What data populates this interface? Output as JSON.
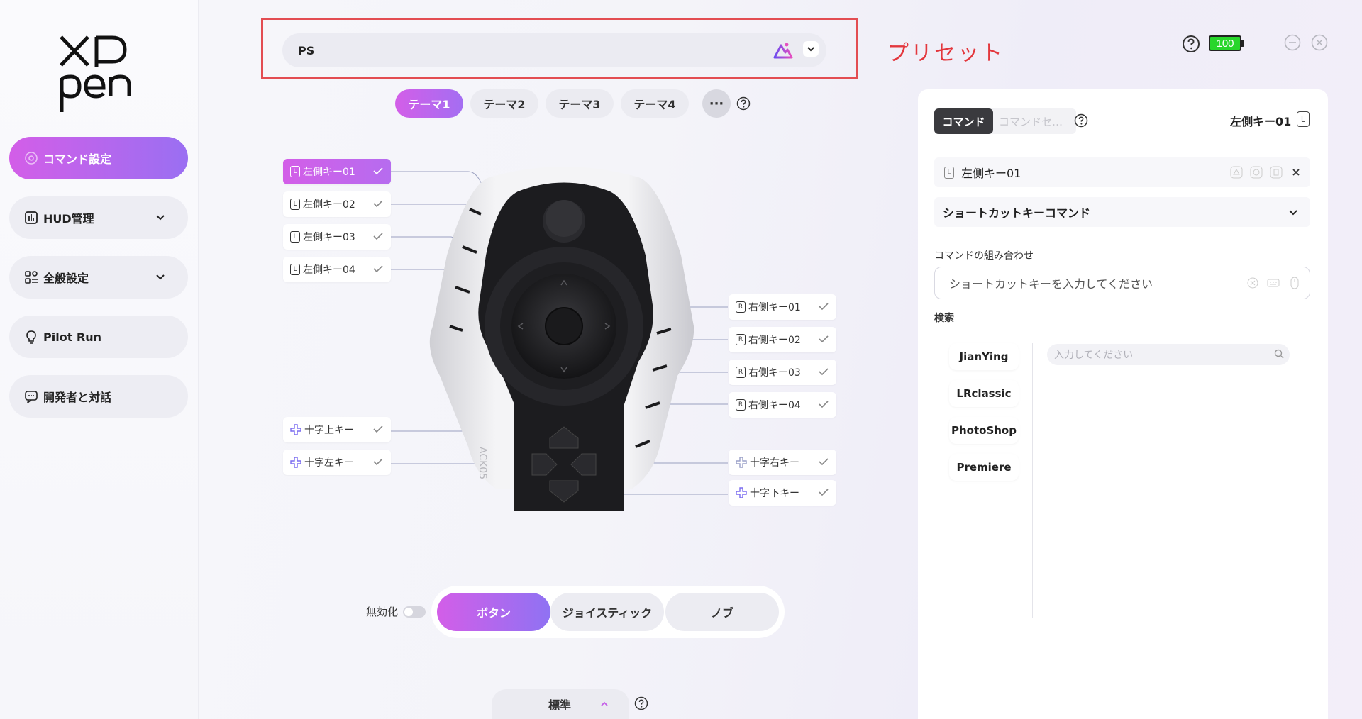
{
  "sidebar": {
    "items": [
      {
        "label": "コマンド設定",
        "icon": "command-icon"
      },
      {
        "label": "HUD管理",
        "icon": "chart-icon"
      },
      {
        "label": "全般設定",
        "icon": "grid-icon"
      },
      {
        "label": "Pilot Run",
        "icon": "bulb-icon"
      },
      {
        "label": "開発者と対話",
        "icon": "chat-icon"
      }
    ]
  },
  "preset": {
    "value": "PS",
    "annotation": "プリセット"
  },
  "battery": {
    "level": "100",
    "color": "#28d62b"
  },
  "themes": {
    "tabs": [
      "テーマ1",
      "テーマ2",
      "テーマ3",
      "テーマ4"
    ],
    "more": "···",
    "active": 0
  },
  "keys": {
    "left": [
      "左側キー01",
      "左側キー02",
      "左側キー03",
      "左側キー04"
    ],
    "right": [
      "右側キー01",
      "右側キー02",
      "右側キー03",
      "右側キー04"
    ],
    "dpad": {
      "up": "十字上キー",
      "left": "十字左キー",
      "right": "十字右キー",
      "down": "十字下キー"
    },
    "left_icon": "L",
    "right_icon": "R"
  },
  "bottom": {
    "disable_label": "無効化",
    "modes": [
      "ボタン",
      "ジョイスティック",
      "ノブ"
    ],
    "standard": "標準"
  },
  "panel": {
    "tab_command": "コマンド",
    "tab_command_set": "コマンドセ…",
    "key_title": "左側キー01",
    "key_icon": "L",
    "key_row": "左側キー01",
    "shortcut_command": "ショートカットキーコマンド",
    "combo_label": "コマンドの組み合わせ",
    "combo_placeholder": "ショートカットキーを入力してください",
    "search_label": "検索",
    "apps": [
      "JianYing",
      "LRclassic",
      "PhotoShop",
      "Premiere"
    ],
    "search_placeholder": "入力してください"
  },
  "colors": {
    "accent_start": "#d35ee8",
    "accent_end": "#9a6ff2",
    "annotation_red": "#e34d52"
  }
}
